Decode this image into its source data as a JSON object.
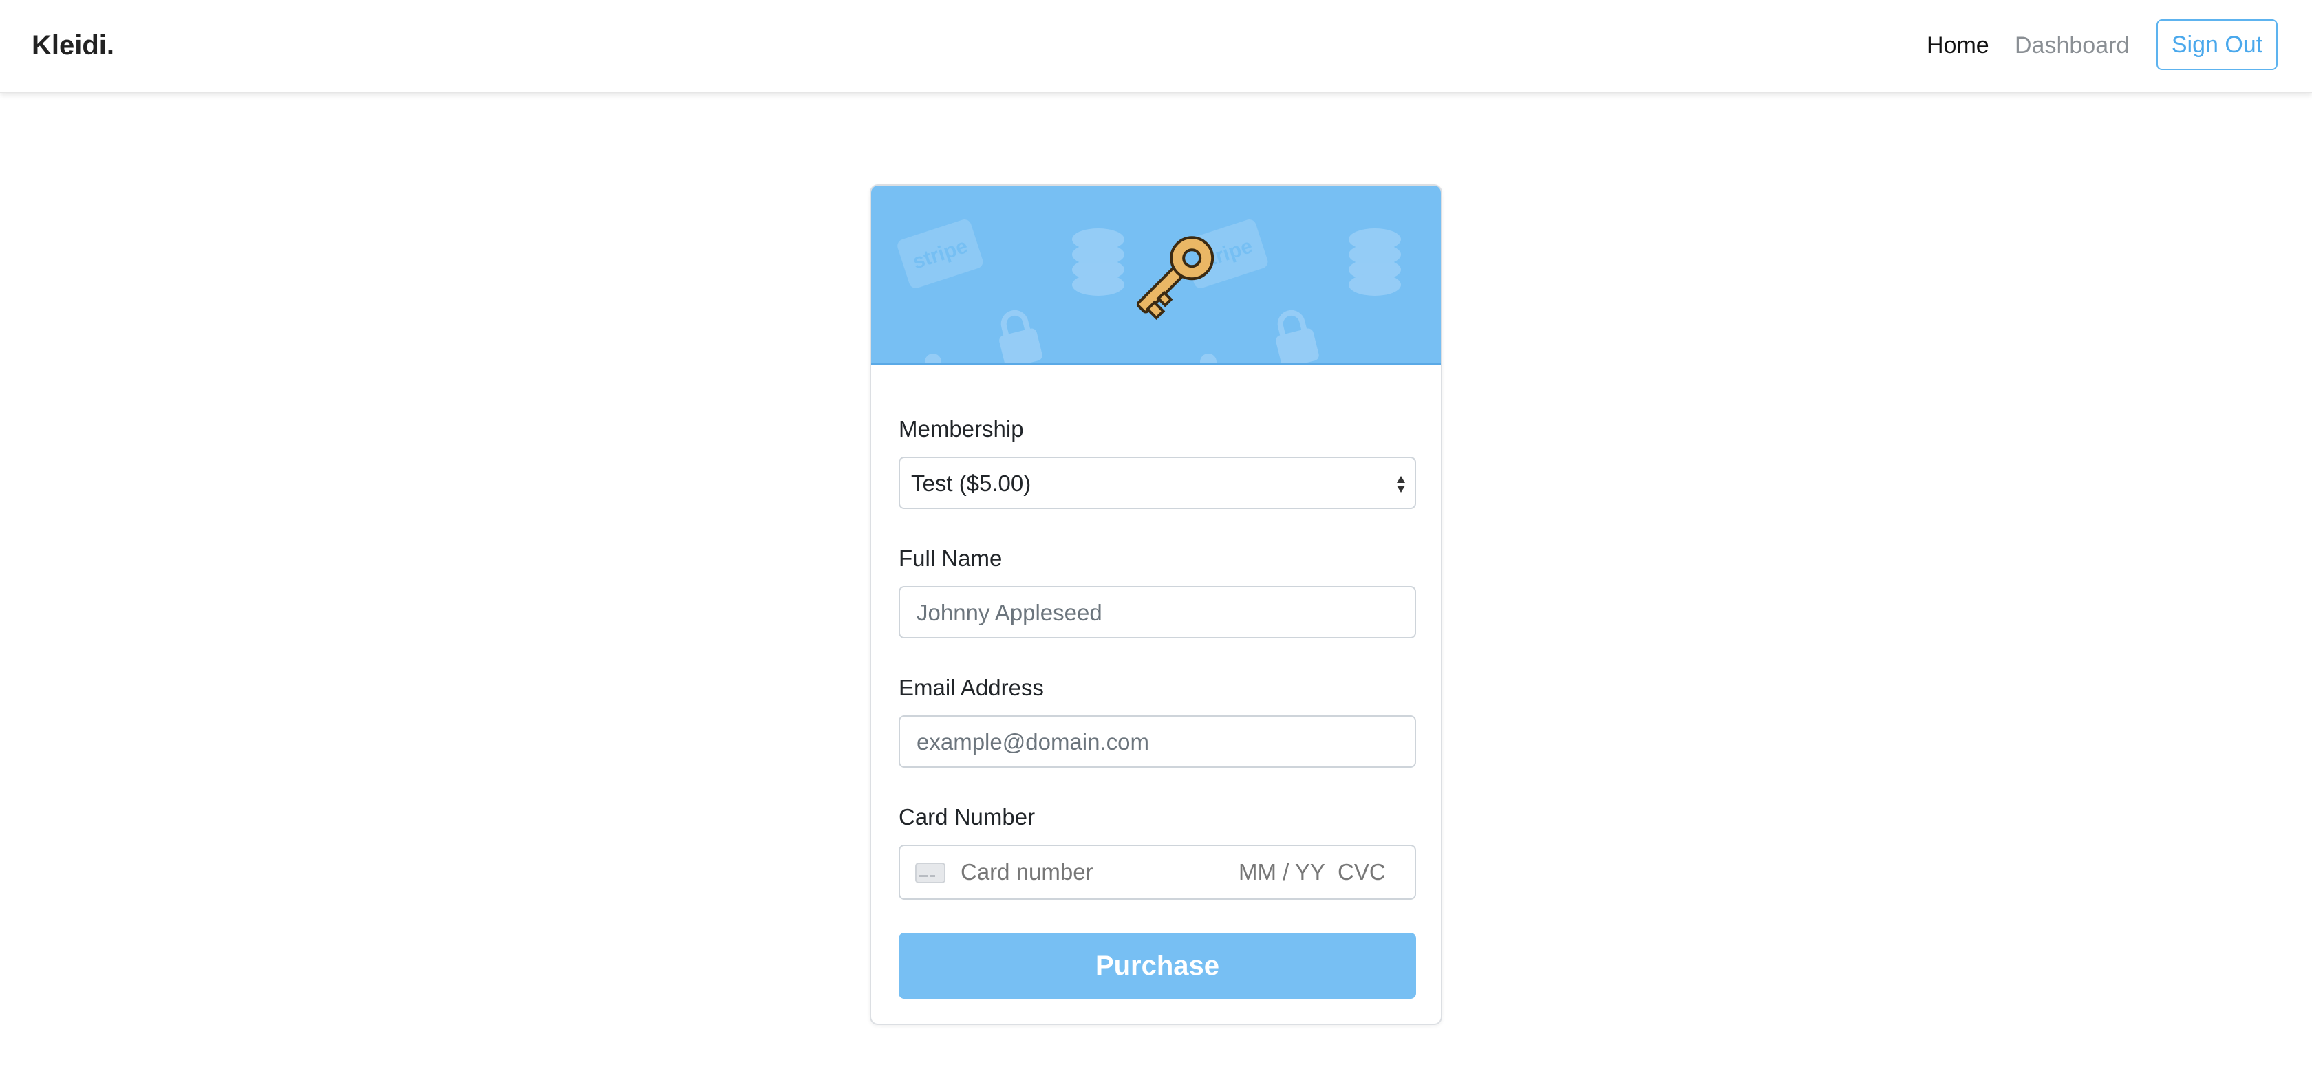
{
  "navbar": {
    "brand": "Kleidi.",
    "links": {
      "home": "Home",
      "dashboard": "Dashboard"
    },
    "sign_out": "Sign Out"
  },
  "form": {
    "header_icons": [
      "key-icon",
      "stripe-card-icon",
      "coin-stack-icon",
      "padlock-icon"
    ],
    "membership": {
      "label": "Membership",
      "selected": "Test ($5.00)"
    },
    "full_name": {
      "label": "Full Name",
      "placeholder": "Johnny Appleseed"
    },
    "email": {
      "label": "Email Address",
      "placeholder": "example@domain.com"
    },
    "card": {
      "label": "Card Number",
      "number_placeholder": "Card number",
      "expiry_placeholder": "MM / YY",
      "cvc_placeholder": "CVC"
    },
    "purchase_label": "Purchase"
  },
  "colors": {
    "accent": "#77bff3",
    "accent_border": "#5db3ef",
    "text": "#212529",
    "muted": "#8a8f94"
  }
}
